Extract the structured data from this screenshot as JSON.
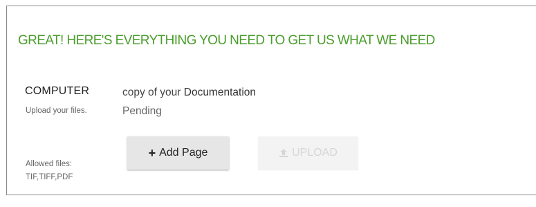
{
  "heading": "GREAT! HERE'S EVERYTHING YOU NEED TO GET US WHAT WE NEED",
  "source": {
    "title": "COMPUTER",
    "description": "Upload your files.",
    "allowed_label": "Allowed files:",
    "allowed_types": "TIF,TIFF,PDF"
  },
  "document": {
    "prefix": "copy of your",
    "name": "Documentation",
    "status": "Pending"
  },
  "buttons": {
    "add_page": {
      "label": "Add Page",
      "icon": "plus-icon"
    },
    "upload": {
      "label": "UPLOAD",
      "icon": "upload-icon",
      "disabled": true
    }
  },
  "colors": {
    "heading": "#4a9d2c",
    "add_button_bg": "#e6e6e6",
    "upload_button_bg": "#f3f3f3",
    "upload_button_text": "#d6d6d6"
  }
}
